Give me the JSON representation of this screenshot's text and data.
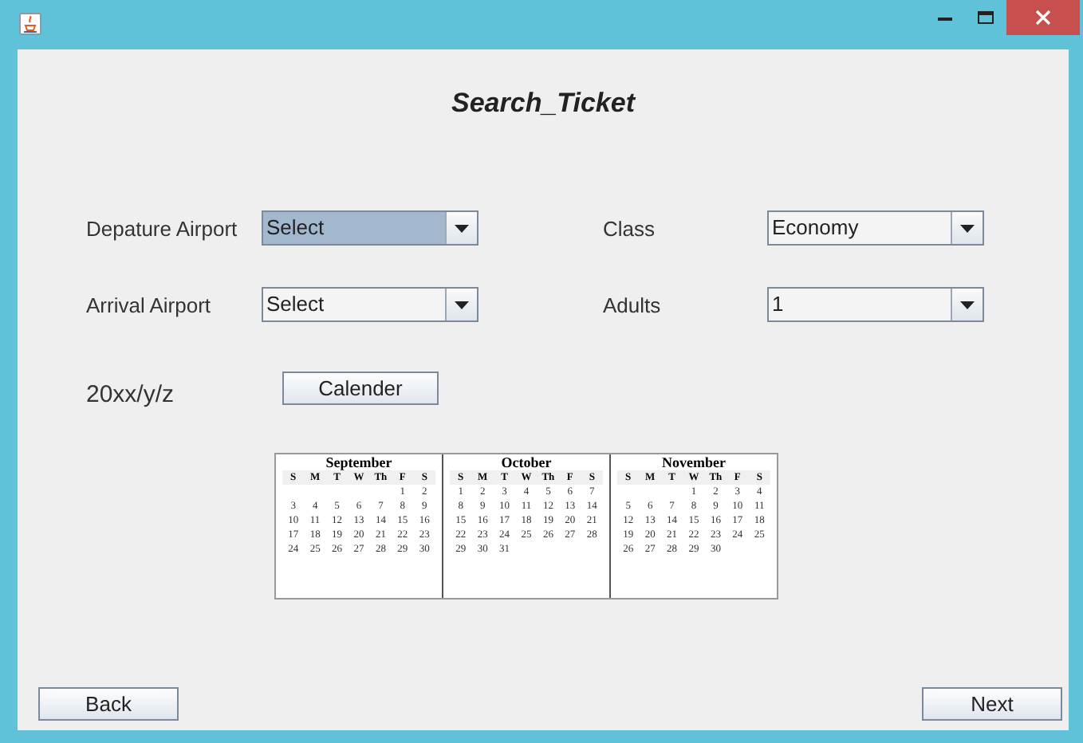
{
  "window": {
    "title": "Search_Ticket"
  },
  "fields": [
    {
      "label": "Depature Airport",
      "value": "Select",
      "highlighted": true
    },
    {
      "label": "Class",
      "value": "Economy",
      "highlighted": false
    },
    {
      "label": "Arrival Airport",
      "value": "Select",
      "highlighted": false
    },
    {
      "label": "Adults",
      "value": "1",
      "highlighted": false
    }
  ],
  "date": {
    "text": "20xx/y/z",
    "button": "Calender"
  },
  "calendar": [
    {
      "month": "September",
      "weekdays": [
        "S",
        "M",
        "T",
        "W",
        "Th",
        "F",
        "S"
      ],
      "weeks": [
        [
          "1",
          "2"
        ],
        [
          "3",
          "4",
          "5",
          "6",
          "7",
          "8",
          "9"
        ],
        [
          "10",
          "11",
          "12",
          "13",
          "14",
          "15",
          "16"
        ],
        [
          "17",
          "18",
          "19",
          "20",
          "21",
          "22",
          "23"
        ],
        [
          "24",
          "25",
          "26",
          "27",
          "28",
          "29",
          "30"
        ]
      ]
    },
    {
      "month": "October",
      "weekdays": [
        "S",
        "M",
        "T",
        "W",
        "Th",
        "F",
        "S"
      ],
      "weeks": [
        [
          "1",
          "2",
          "3",
          "4",
          "5",
          "6",
          "7"
        ],
        [
          "8",
          "9",
          "10",
          "11",
          "12",
          "13",
          "14"
        ],
        [
          "15",
          "16",
          "17",
          "18",
          "19",
          "20",
          "21"
        ],
        [
          "22",
          "23",
          "24",
          "25",
          "26",
          "27",
          "28"
        ],
        [
          "29",
          "30",
          "31"
        ]
      ]
    },
    {
      "month": "November",
      "weekdays": [
        "S",
        "M",
        "T",
        "W",
        "Th",
        "F",
        "S"
      ],
      "weeks": [
        [
          "1",
          "2",
          "3",
          "4"
        ],
        [
          "5",
          "6",
          "7",
          "8",
          "9",
          "10",
          "11"
        ],
        [
          "12",
          "13",
          "14",
          "15",
          "16",
          "17",
          "18"
        ],
        [
          "19",
          "20",
          "21",
          "22",
          "23",
          "24",
          "25"
        ],
        [
          "26",
          "27",
          "28",
          "29",
          "30"
        ]
      ]
    }
  ],
  "buttons": {
    "back": "Back",
    "next": "Next"
  }
}
